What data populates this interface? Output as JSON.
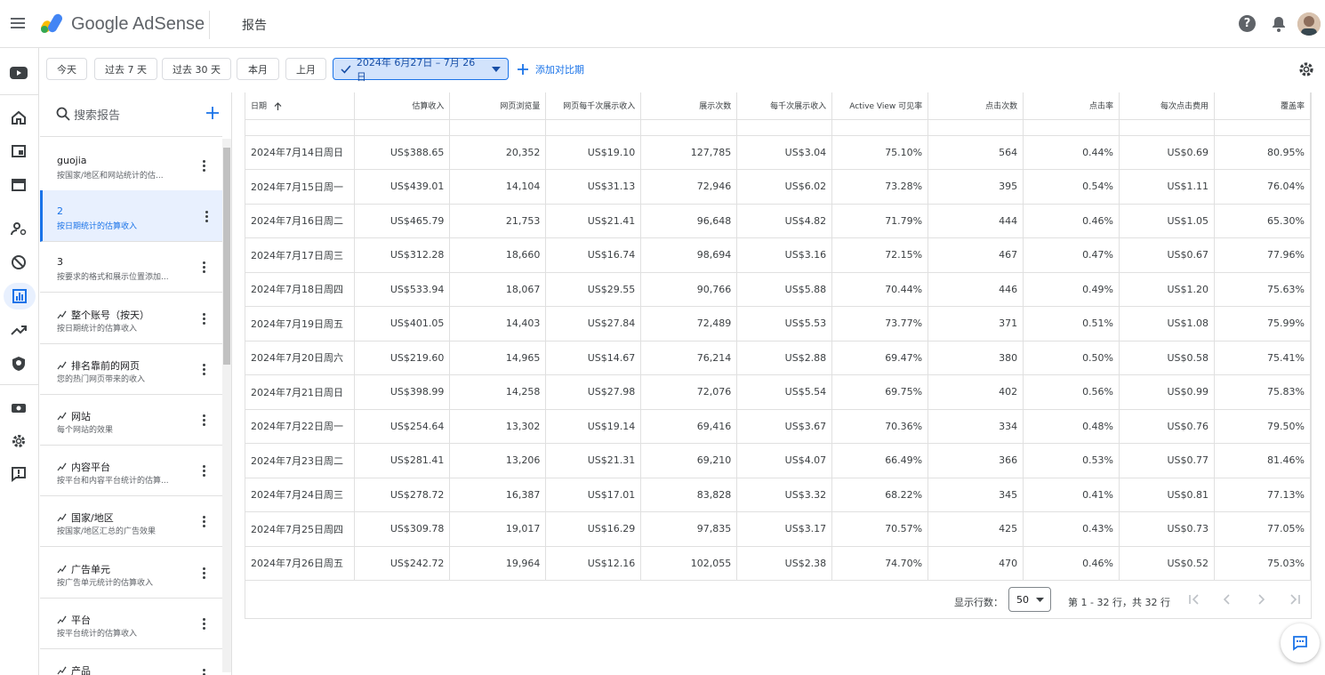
{
  "app": {
    "brand": "Google AdSense",
    "page_title": "报告"
  },
  "filters": {
    "chips": [
      "今天",
      "过去 7 天",
      "过去 30 天",
      "本月",
      "上月"
    ],
    "date_range": "2024年 6月27日 – 7月 26日",
    "add_compare": "添加对比期"
  },
  "sidebar": {
    "search_placeholder": "搜索报告",
    "items": [
      {
        "title": "guojia",
        "subtitle": "按国家/地区和网站统计的估...",
        "starred": false
      },
      {
        "title": "2",
        "subtitle": "按日期统计的估算收入",
        "starred": false
      },
      {
        "title": "3",
        "subtitle": "按要求的格式和展示位置添加...",
        "starred": false
      },
      {
        "title": "整个账号（按天）",
        "subtitle": "按日期统计的估算收入",
        "starred": true
      },
      {
        "title": "排名靠前的网页",
        "subtitle": "您的热门网页带来的收入",
        "starred": true
      },
      {
        "title": "网站",
        "subtitle": "每个网站的效果",
        "starred": true
      },
      {
        "title": "内容平台",
        "subtitle": "按平台和内容平台统计的估算...",
        "starred": true
      },
      {
        "title": "国家/地区",
        "subtitle": "按国家/地区汇总的广告效果",
        "starred": true
      },
      {
        "title": "广告单元",
        "subtitle": "按广告单元统计的估算收入",
        "starred": true
      },
      {
        "title": "平台",
        "subtitle": "按平台统计的估算收入",
        "starred": true
      },
      {
        "title": "产品",
        "subtitle": "",
        "starred": true
      }
    ]
  },
  "table": {
    "headers": [
      "日期",
      "估算收入",
      "网页浏览量",
      "网页每千次展示收入",
      "展示次数",
      "每千次展示收入",
      "Active View 可见率",
      "点击次数",
      "点击率",
      "每次点击费用",
      "覆盖率"
    ],
    "rows": [
      [
        "2024年7月14日周日",
        "US$388.65",
        "20,352",
        "US$19.10",
        "127,785",
        "US$3.04",
        "75.10%",
        "564",
        "0.44%",
        "US$0.69",
        "80.95%"
      ],
      [
        "2024年7月15日周一",
        "US$439.01",
        "14,104",
        "US$31.13",
        "72,946",
        "US$6.02",
        "73.28%",
        "395",
        "0.54%",
        "US$1.11",
        "76.04%"
      ],
      [
        "2024年7月16日周二",
        "US$465.79",
        "21,753",
        "US$21.41",
        "96,648",
        "US$4.82",
        "71.79%",
        "444",
        "0.46%",
        "US$1.05",
        "65.30%"
      ],
      [
        "2024年7月17日周三",
        "US$312.28",
        "18,660",
        "US$16.74",
        "98,694",
        "US$3.16",
        "72.15%",
        "467",
        "0.47%",
        "US$0.67",
        "77.96%"
      ],
      [
        "2024年7月18日周四",
        "US$533.94",
        "18,067",
        "US$29.55",
        "90,766",
        "US$5.88",
        "70.44%",
        "446",
        "0.49%",
        "US$1.20",
        "75.63%"
      ],
      [
        "2024年7月19日周五",
        "US$401.05",
        "14,403",
        "US$27.84",
        "72,489",
        "US$5.53",
        "73.77%",
        "371",
        "0.51%",
        "US$1.08",
        "75.99%"
      ],
      [
        "2024年7月20日周六",
        "US$219.60",
        "14,965",
        "US$14.67",
        "76,214",
        "US$2.88",
        "69.47%",
        "380",
        "0.50%",
        "US$0.58",
        "75.41%"
      ],
      [
        "2024年7月21日周日",
        "US$398.99",
        "14,258",
        "US$27.98",
        "72,076",
        "US$5.54",
        "69.75%",
        "402",
        "0.56%",
        "US$0.99",
        "75.83%"
      ],
      [
        "2024年7月22日周一",
        "US$254.64",
        "13,302",
        "US$19.14",
        "69,416",
        "US$3.67",
        "70.36%",
        "334",
        "0.48%",
        "US$0.76",
        "79.50%"
      ],
      [
        "2024年7月23日周二",
        "US$281.41",
        "13,206",
        "US$21.31",
        "69,210",
        "US$4.07",
        "66.49%",
        "366",
        "0.53%",
        "US$0.77",
        "81.46%"
      ],
      [
        "2024年7月24日周三",
        "US$278.72",
        "16,387",
        "US$17.01",
        "83,828",
        "US$3.32",
        "68.22%",
        "345",
        "0.41%",
        "US$0.81",
        "77.13%"
      ],
      [
        "2024年7月25日周四",
        "US$309.78",
        "19,017",
        "US$16.29",
        "97,835",
        "US$3.17",
        "70.57%",
        "425",
        "0.43%",
        "US$0.73",
        "77.05%"
      ],
      [
        "2024年7月26日周五",
        "US$242.72",
        "19,964",
        "US$12.16",
        "102,055",
        "US$2.38",
        "74.70%",
        "470",
        "0.46%",
        "US$0.52",
        "75.03%"
      ]
    ]
  },
  "pagination": {
    "rows_label": "显示行数：",
    "rows_value": "50",
    "range": "第 1 - 32 行，共 32 行"
  },
  "colors": {
    "accent": "#1a73e8",
    "selected_bg": "#e8f0fe"
  }
}
